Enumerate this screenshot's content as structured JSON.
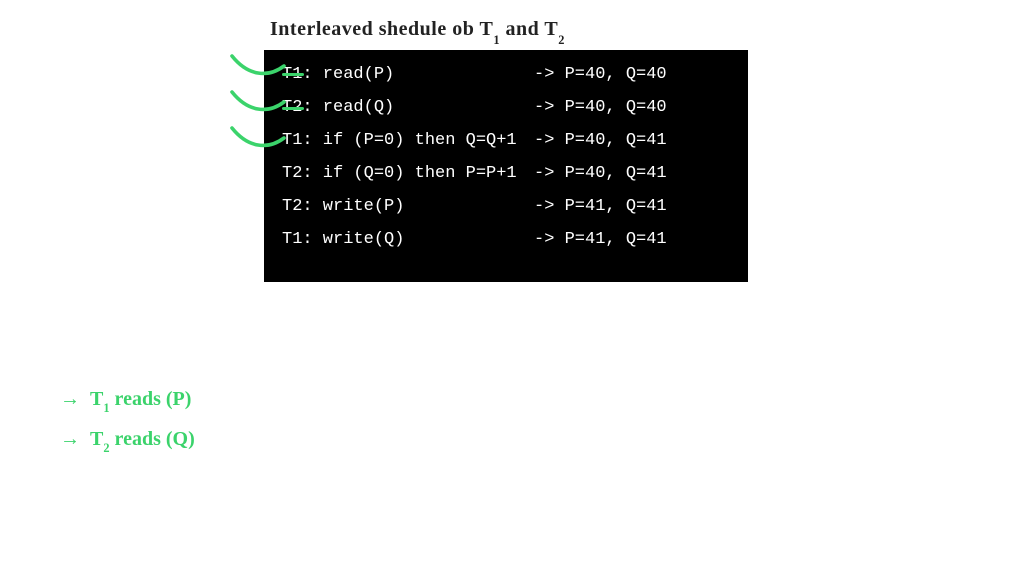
{
  "title": {
    "pre": "Interleaved  shedule ob T",
    "sub1": "1",
    "mid": " and T",
    "sub2": "2"
  },
  "terminal": {
    "rows": [
      {
        "op": "T1: read(P)",
        "res": "-> P=40, Q=40"
      },
      {
        "op": "T2: read(Q)",
        "res": "-> P=40, Q=40"
      },
      {
        "op": "T1: if (P=0) then Q=Q+1",
        "res": "-> P=40, Q=41"
      },
      {
        "op": "T2: if (Q=0) then P=P+1",
        "res": "-> P=40, Q=41"
      },
      {
        "op": "T2: write(P)",
        "res": "-> P=41, Q=41"
      },
      {
        "op": "T1: write(Q)",
        "res": "-> P=41, Q=41"
      }
    ]
  },
  "checks_count": 3,
  "notes": {
    "arrow": "→",
    "lines": [
      {
        "t_pre": "T",
        "t_sub": "1",
        "rest": " reads (P)"
      },
      {
        "t_pre": "T",
        "t_sub": "2",
        "rest": " reads (Q)"
      }
    ]
  },
  "colors": {
    "highlight": "#3bd36b",
    "terminal_bg": "#000000",
    "terminal_fg": "#ffffff"
  }
}
